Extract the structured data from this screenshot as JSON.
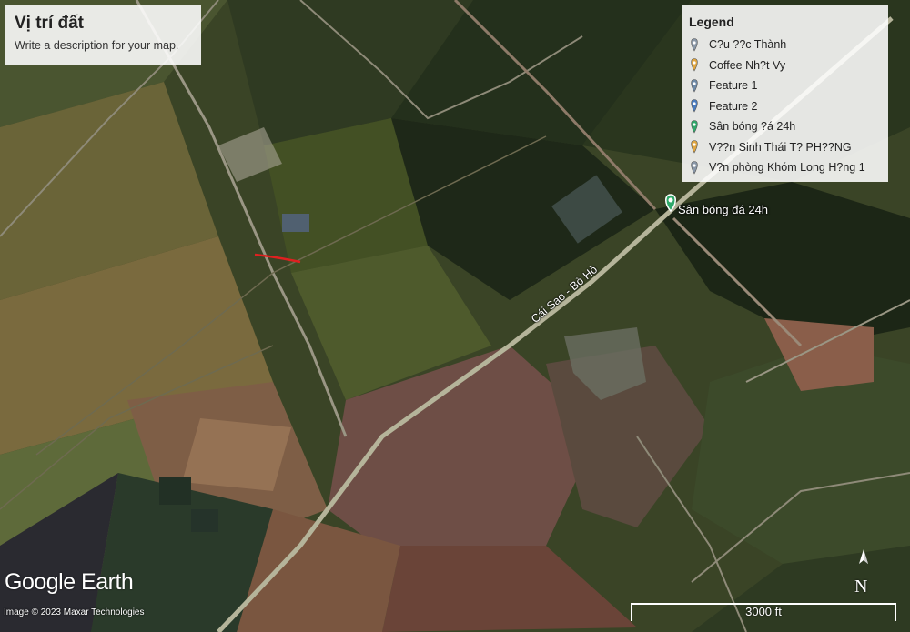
{
  "title_card": {
    "title": "Vị trí đất",
    "description": "Write a description for your map."
  },
  "legend": {
    "heading": "Legend",
    "items": [
      {
        "label": "C?u ??c Thành",
        "color": "#8a98a8",
        "icon": "map-pin-icon"
      },
      {
        "label": "Coffee Nh?t Vy",
        "color": "#e0a640",
        "icon": "map-pin-icon"
      },
      {
        "label": "Feature 1",
        "color": "#6e8aa8",
        "icon": "map-pin-icon"
      },
      {
        "label": "Feature 2",
        "color": "#4a7cc0",
        "icon": "map-pin-icon"
      },
      {
        "label": "Sân bóng ?á 24h",
        "color": "#2fa86a",
        "icon": "map-pin-icon"
      },
      {
        "label": "V??n Sinh Thái T? PH??NG",
        "color": "#e0a640",
        "icon": "map-pin-icon"
      },
      {
        "label": "V?n phòng Khóm Long H?ng 1",
        "color": "#8a98a8",
        "icon": "map-pin-icon"
      }
    ]
  },
  "placemarks": [
    {
      "label": "Sân bóng đá 24h",
      "color": "#2fa86a"
    }
  ],
  "road_label": "Cái Sao - Bò Hò",
  "brand": "Google Earth",
  "credit": "Image © 2023 Maxar Technologies",
  "north_letter": "N",
  "scale_label": "3000 ft"
}
